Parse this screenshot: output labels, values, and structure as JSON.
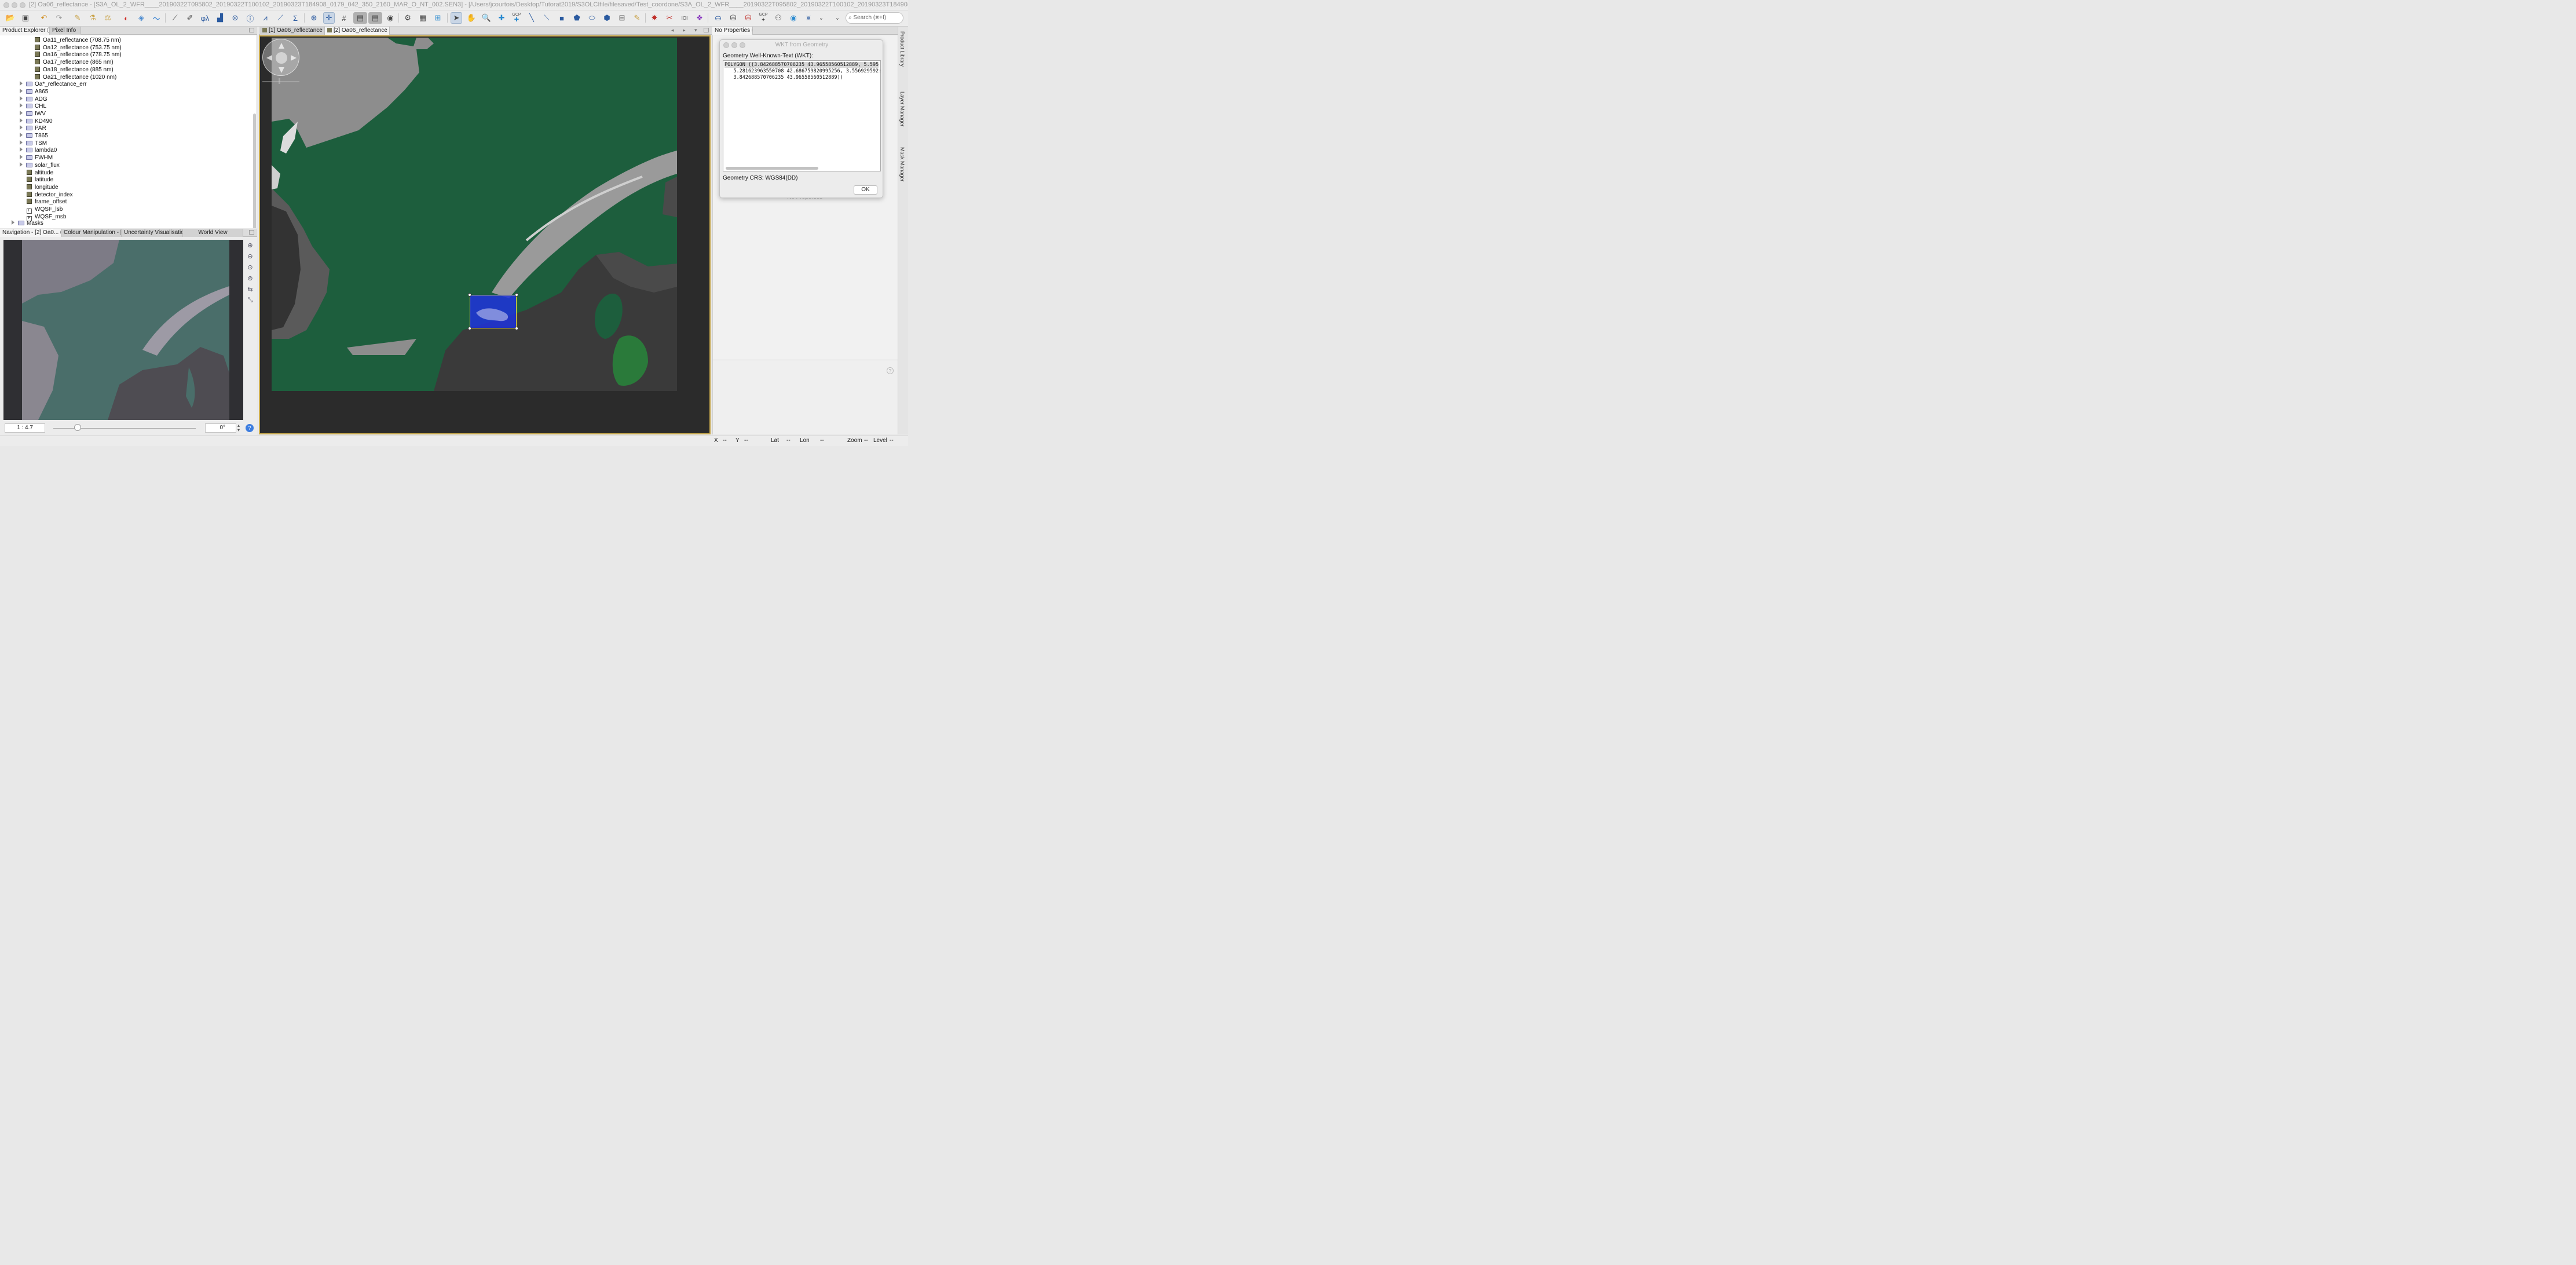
{
  "window": {
    "title": "[2] Oa06_reflectance - [S3A_OL_2_WFR____20190322T095802_20190322T100102_20190323T184908_0179_042_350_2160_MAR_O_NT_002.SEN3] - [/Users/jcourtois/Desktop/Tutorat2019/S3OLCIfile/filesaved/Test_coordone/S3A_OL_2_WFR____20190322T095802_20190322T100102_20190323T184908_0179_042_350_2160_MAR_O_NT_"
  },
  "toolbar": {
    "search_placeholder": "Search (⌘+I)",
    "gcp_label_1": "GCP",
    "gcp_label_2": "GCP"
  },
  "left_tabs": {
    "product_explorer": "Product Explorer",
    "pixel_info": "Pixel Info"
  },
  "tree": {
    "bands": [
      "Oa11_reflectance (708.75 nm)",
      "Oa12_reflectance (753.75 nm)",
      "Oa16_reflectance (778.75 nm)",
      "Oa17_reflectance (865 nm)",
      "Oa18_reflectance (885 nm)",
      "Oa21_reflectance (1020 nm)"
    ],
    "folders": [
      "Oa*_reflectance_err",
      "A865",
      "ADG",
      "CHL",
      "IWV",
      "KD490",
      "PAR",
      "T865",
      "TSM",
      "lambda0",
      "FWHM",
      "solar_flux"
    ],
    "leaves": [
      "altitude",
      "latitude",
      "longitude",
      "detector_index",
      "frame_offset"
    ],
    "flags": [
      "WQSF_lsb",
      "WQSF_msb"
    ],
    "masks": "Masks"
  },
  "nav_tabs": {
    "navigation": "Navigation - [2] Oa0...",
    "colour": "Colour Manipulation - [...",
    "uncertainty": "Uncertainty Visualisatio...",
    "world": "World View"
  },
  "navigation": {
    "scale": "1 : 4.7",
    "angle": "0°",
    "zoom_fraction": 0.17
  },
  "view_tabs": {
    "tab1": "[1] Oa06_reflectance",
    "tab2": "[2] Oa06_reflectance"
  },
  "right_panel": {
    "tab": "No Properties",
    "hint": "No Properties",
    "side_labels": [
      "Product Library",
      "Layer Manager",
      "Mask Manager"
    ]
  },
  "dialog": {
    "title": "WKT from Geometry",
    "wkt_label": "Geometry Well-Known-Text (WKT):",
    "wkt_line1": "POLYGON ((3.842688570706235 43.96558560512889, 5.595",
    "wkt_line2": "   5.281623963550708 42.686759820995256, 3.556929592:",
    "wkt_line3": "   3.842688570706235 43.96558560512889))",
    "crs": "Geometry CRS: WGS84(DD)",
    "ok": "OK"
  },
  "status": {
    "x_label": "X",
    "x_val": "--",
    "y_label": "Y",
    "y_val": "--",
    "lat_label": "Lat",
    "lat_val": "--",
    "lon_label": "Lon",
    "lon_val": "--",
    "zoom_label": "Zoom",
    "zoom_val": "--",
    "level_label": "Level",
    "level_val": "--"
  },
  "colors": {
    "water": "#1d5e3d",
    "land_dark": "#3a3a3a",
    "roi_fill": "#1e32dc",
    "roi_border": "#f2e24a",
    "view_border": "#c8a84a"
  }
}
